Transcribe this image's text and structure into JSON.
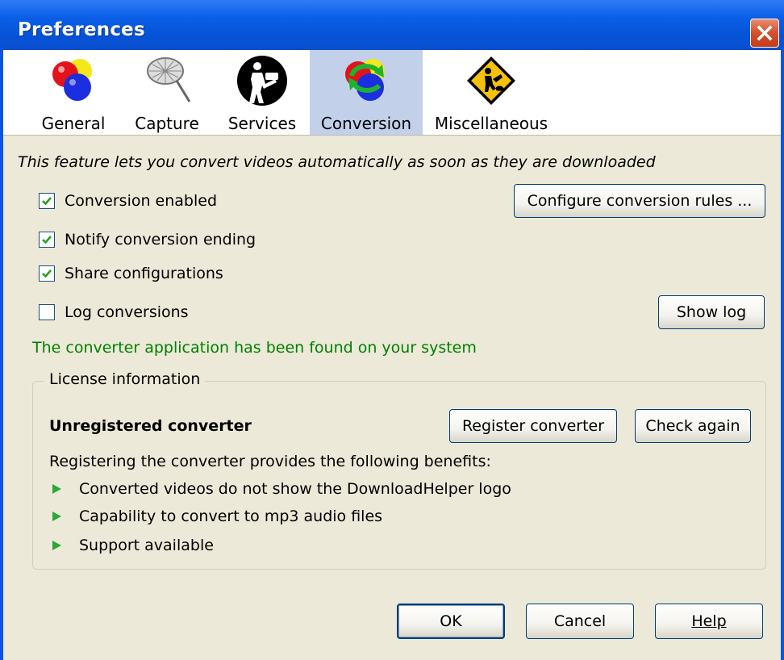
{
  "window": {
    "title": "Preferences"
  },
  "tabs": [
    {
      "label": "General",
      "icon": "general-icon"
    },
    {
      "label": "Capture",
      "icon": "capture-net-icon"
    },
    {
      "label": "Services",
      "icon": "services-icon"
    },
    {
      "label": "Conversion",
      "icon": "conversion-icon",
      "active": true
    },
    {
      "label": "Miscellaneous",
      "icon": "miscellaneous-icon"
    }
  ],
  "conversion": {
    "intro": "This feature lets you convert videos automatically as soon as they are downloaded",
    "options": [
      {
        "label": "Conversion enabled",
        "checked": true
      },
      {
        "label": "Notify conversion ending",
        "checked": true
      },
      {
        "label": "Share configurations",
        "checked": true
      },
      {
        "label": "Log conversions",
        "checked": false
      }
    ],
    "configure_button": "Configure conversion rules ...",
    "show_log_button": "Show log",
    "status": "The converter application has been found on your system"
  },
  "license": {
    "legend": "License information",
    "status": "Unregistered converter",
    "register_button": "Register converter",
    "check_button": "Check again",
    "benefits_intro": "Registering the converter provides the following benefits:",
    "benefits": [
      "Converted videos do not show the DownloadHelper logo",
      "Capability to convert to mp3 audio files",
      "Support available"
    ]
  },
  "footer": {
    "ok": "OK",
    "cancel": "Cancel",
    "help": "Help"
  },
  "colors": {
    "titlebar": "#0a5fe6",
    "status_text": "#008000",
    "active_tab": "#c2d0ea",
    "dialog_bg": "#ece9d8"
  }
}
